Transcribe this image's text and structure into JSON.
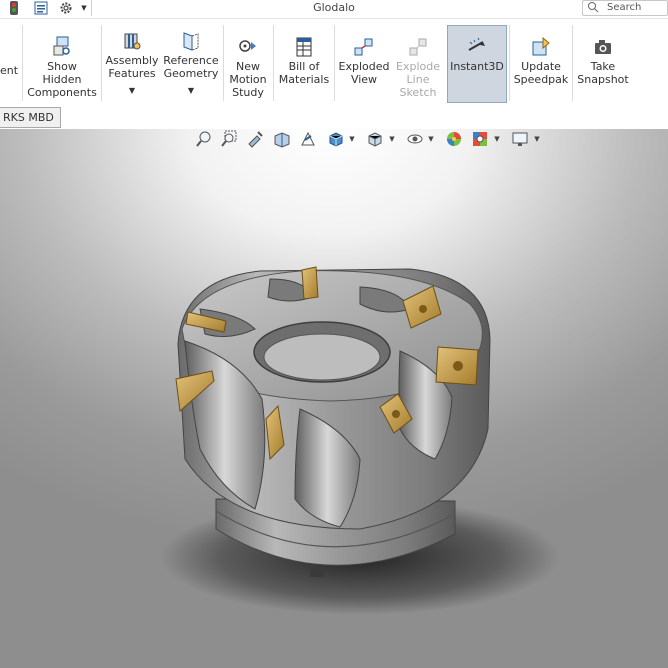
{
  "window": {
    "title": "Glodalo",
    "search_placeholder": "Search"
  },
  "ribbon": {
    "buttons": [
      {
        "id": "partial",
        "label": "ent"
      },
      {
        "id": "show-hidden",
        "label": "Show\nHidden\nComponents"
      },
      {
        "id": "assembly-features",
        "label": "Assembly\nFeatures"
      },
      {
        "id": "reference-geometry",
        "label": "Reference\nGeometry"
      },
      {
        "id": "motion-study",
        "label": "New\nMotion\nStudy"
      },
      {
        "id": "bom",
        "label": "Bill of\nMaterials"
      },
      {
        "id": "exploded-view",
        "label": "Exploded\nView"
      },
      {
        "id": "explode-line",
        "label": "Explode\nLine\nSketch",
        "disabled": true
      },
      {
        "id": "instant3d",
        "label": "Instant3D",
        "active": true
      },
      {
        "id": "speedpak",
        "label": "Update\nSpeedpak"
      },
      {
        "id": "snapshot",
        "label": "Take\nSnapshot"
      }
    ]
  },
  "tabs": {
    "mbd_label": "RKS MBD"
  },
  "colors": {
    "accent": "#8fa7c2",
    "insert_gold": "#c9a24a",
    "body_gray": "#8d8d8d"
  },
  "viewport": {
    "model_name": "face mill cutter with 6 carbide inserts"
  }
}
